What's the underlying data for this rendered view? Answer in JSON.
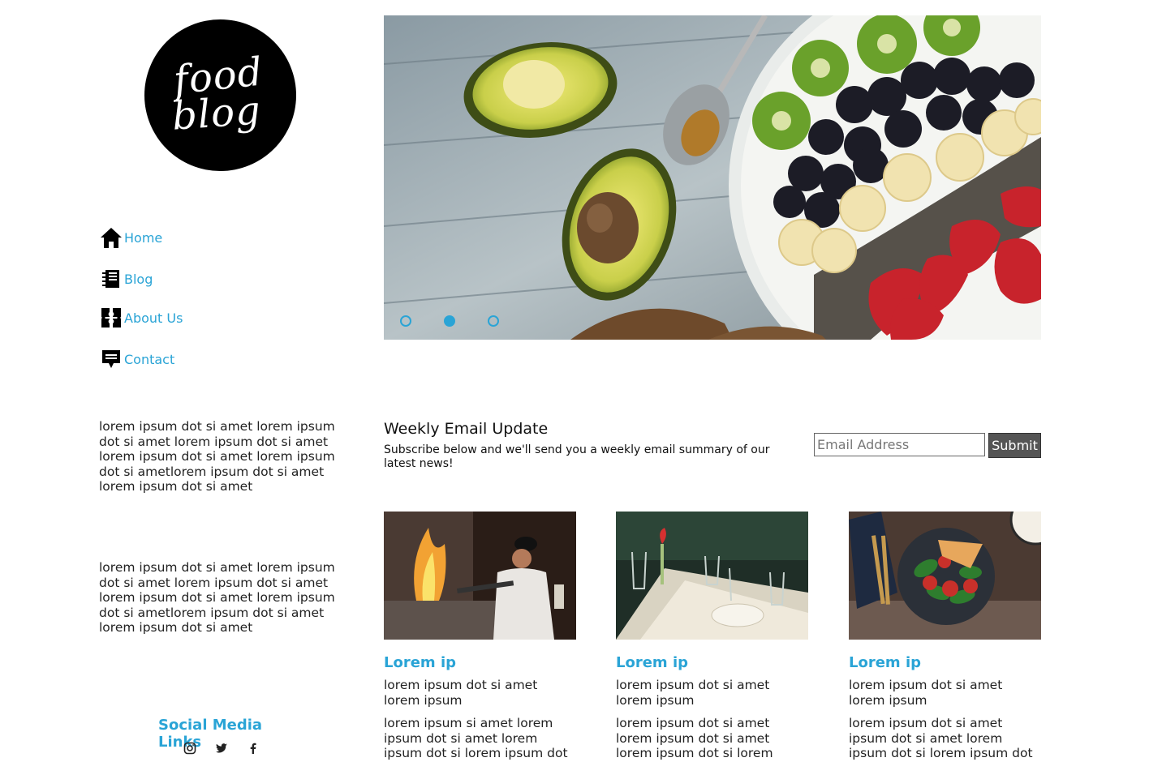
{
  "logo": {
    "line1": "food",
    "line2": "blog"
  },
  "nav": {
    "items": [
      {
        "label": "Home",
        "icon": "home-icon"
      },
      {
        "label": "Blog",
        "icon": "notebook-icon"
      },
      {
        "label": "About Us",
        "icon": "puzzle-icon"
      },
      {
        "label": "Contact",
        "icon": "chat-icon"
      }
    ]
  },
  "sidebar": {
    "text1": "lorem ipsum dot si amet lorem ipsum dot si amet lorem ipsum dot si amet lorem ipsum dot si amet lorem ipsum dot si ametlorem ipsum dot si amet lorem ipsum dot si amet",
    "text2": "lorem ipsum dot si amet lorem ipsum dot si amet lorem ipsum dot si amet lorem ipsum dot si amet lorem ipsum dot si ametlorem ipsum dot si amet lorem ipsum dot si amet",
    "social_title": "Social Media Links",
    "social_icons": [
      "instagram-icon",
      "twitter-icon",
      "facebook-icon"
    ]
  },
  "slider": {
    "dots": 3,
    "active_dot": 2
  },
  "newsletter": {
    "title": "Weekly Email Update",
    "description": "Subscribe below and we'll send you a weekly email summary of our latest news!",
    "email_placeholder": "Email Address",
    "submit_label": "Submit"
  },
  "cards": [
    {
      "title": "Lorem ip",
      "p1": "lorem ipsum dot si amet lorem ipsum",
      "p2": "lorem ipsum si amet lorem ipsum dot si amet lorem ipsum dot si lorem ipsum dot"
    },
    {
      "title": "Lorem ip",
      "p1": "lorem ipsum dot si amet lorem ipsum",
      "p2": "lorem ipsum dot si amet lorem ipsum dot si amet lorem ipsum dot si lorem"
    },
    {
      "title": "Lorem ip",
      "p1": "lorem ipsum dot si amet lorem ipsum",
      "p2": "lorem ipsum dot si amet ipsum dot si amet lorem ipsum dot si lorem ipsum dot"
    }
  ],
  "colors": {
    "accent": "#2aa4d6",
    "button": "#555555"
  }
}
